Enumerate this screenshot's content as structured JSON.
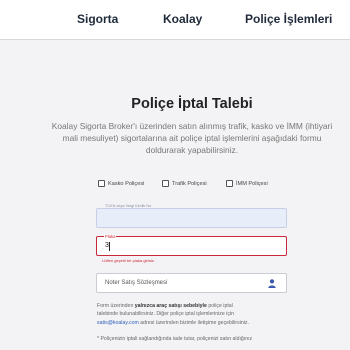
{
  "nav": {
    "items": [
      "Sigorta",
      "Koalay",
      "Poliçe İşlemleri"
    ]
  },
  "page": {
    "title": "Poliçe İptal Talebi",
    "intro_lines": [
      "Koalay Sigorta Broker'ı üzerinden satın alınmış trafik, kasko ve İMM (ihtiyari",
      "mali mesuliyet) sigortalarına ait poliçe iptal işlemlerini aşağıdaki formu",
      "doldurarak yapabilirsiniz."
    ]
  },
  "policy_types": [
    {
      "label": "Kasko Poliçesi",
      "checked": false
    },
    {
      "label": "Trafik Poliçesi",
      "checked": false
    },
    {
      "label": "İMM Poliçesi",
      "checked": false
    }
  ],
  "form": {
    "tc_label": "TCKN veya Vergi Kimlik No",
    "tc_value": "",
    "plaka_label": "Plaka",
    "plaka_value": "3",
    "plaka_error": "Lütfen geçerli bir plaka giriniz.",
    "noter_placeholder": "Noter Satış Sözleşmesi",
    "upload_icon": "user-upload-icon"
  },
  "info": {
    "line1_pre": "Form üzerinden ",
    "line1_bold": "yalnızca araç satışı sebebiyle",
    "line1_post": " poliçe iptal",
    "line2": "talebinde bulunabilirsiniz. Diğer poliçe iptal işlemlerinize için",
    "line3_link": "satis@koalay.com",
    "line3_post": " adresi üzerinden bizimle iletişime geçebilirsiniz."
  },
  "note": {
    "line1": "* Poliçenizin iptali sağlandığında iade tutar, poliçenizi satın aldığınız"
  },
  "colors": {
    "error": "#c8283a",
    "link": "#2c5db8",
    "title": "#222222"
  }
}
